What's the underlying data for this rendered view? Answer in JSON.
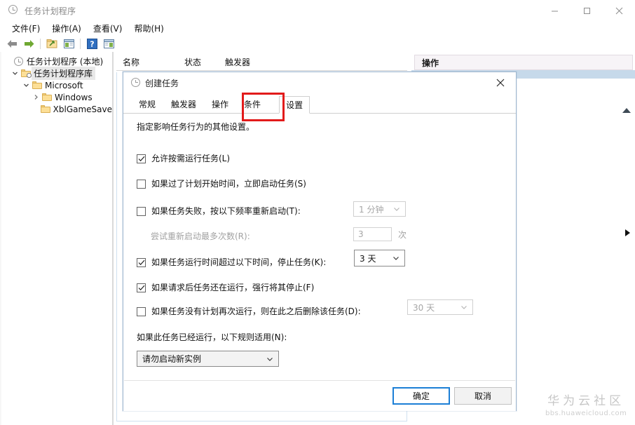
{
  "window": {
    "title": "任务计划程序",
    "icon": "clock-icon",
    "controls": {
      "minimize": "minimize-icon",
      "maximize": "maximize-icon",
      "close": "close-icon"
    }
  },
  "menubar": {
    "items": [
      {
        "label": "文件(F)",
        "name": "menu-file"
      },
      {
        "label": "操作(A)",
        "name": "menu-action"
      },
      {
        "label": "查看(V)",
        "name": "menu-view"
      },
      {
        "label": "帮助(H)",
        "name": "menu-help"
      }
    ]
  },
  "toolbar": {
    "buttons": [
      {
        "name": "back-arrow-icon"
      },
      {
        "name": "forward-arrow-icon"
      },
      {
        "name": "new-folder-icon"
      },
      {
        "name": "properties-icon"
      },
      {
        "name": "help-icon"
      },
      {
        "name": "show-pane-icon"
      }
    ]
  },
  "tree": {
    "nodes": [
      {
        "label": "任务计划程序 (本地)",
        "icon": "clock-icon",
        "indent": 0,
        "chevron": "none",
        "selected": false
      },
      {
        "label": "任务计划程序库",
        "icon": "folder-clock-icon",
        "indent": 1,
        "chevron": "down",
        "selected": true
      },
      {
        "label": "Microsoft",
        "icon": "folder-icon",
        "indent": 2,
        "chevron": "down",
        "selected": false
      },
      {
        "label": "Windows",
        "icon": "folder-icon",
        "indent": 3,
        "chevron": "right",
        "selected": false
      },
      {
        "label": "XblGameSave",
        "icon": "folder-icon",
        "indent": 3,
        "chevron": "none",
        "selected": false
      }
    ]
  },
  "list": {
    "columns": [
      "名称",
      "状态",
      "触发器"
    ]
  },
  "actions_pane": {
    "title": "操作"
  },
  "dialog": {
    "title": "创建任务",
    "icon": "clock-icon",
    "close_label": "关闭",
    "tabs": [
      {
        "label": "常规",
        "active": false
      },
      {
        "label": "触发器",
        "active": false
      },
      {
        "label": "操作",
        "active": false
      },
      {
        "label": "条件",
        "active": false
      },
      {
        "label": "设置",
        "active": true
      }
    ],
    "description": "指定影响任务行为的其他设置。",
    "options": [
      {
        "label": "允许按需运行任务(L)",
        "checked": true,
        "disabled": false,
        "accel": "L"
      },
      {
        "label": "如果过了计划开始时间，立即启动任务(S)",
        "checked": false,
        "disabled": false,
        "accel": "S"
      },
      {
        "label": "如果任务失败，按以下频率重新启动(T):",
        "checked": false,
        "disabled": false,
        "accel": "T"
      },
      {
        "label": "尝试重新启动最多次数(R):",
        "checked": null,
        "disabled": true,
        "accel": "R"
      },
      {
        "label": "如果任务运行时间超过以下时间，停止任务(K):",
        "checked": true,
        "disabled": false,
        "accel": "K"
      },
      {
        "label": "如果请求后任务还在运行，强行将其停止(F)",
        "checked": true,
        "disabled": false,
        "accel": "F"
      },
      {
        "label": "如果任务没有计划再次运行，则在此之后删除该任务(D):",
        "checked": false,
        "disabled": false,
        "accel": "D"
      }
    ],
    "controls": {
      "restart_interval": {
        "value": "1 分钟",
        "disabled": true
      },
      "restart_attempts": {
        "value": "3",
        "disabled": true,
        "unit": "次"
      },
      "stop_after": {
        "value": "3 天",
        "disabled": false
      },
      "delete_after": {
        "value": "30 天",
        "disabled": true
      }
    },
    "rules_label": "如果此任务已经运行，以下规则适用(N):",
    "rules_select": {
      "value": "请勿启动新实例"
    },
    "buttons": {
      "ok": "确定",
      "cancel": "取消"
    }
  },
  "watermark": {
    "main": "华为云社区",
    "sub": "bbs.huaweicloud.com"
  },
  "colors": {
    "accent": "#1c7fd6",
    "highlight_box": "#e21b1b",
    "actions_header_bg": "#f7f4f7",
    "selection_bg": "#e8e8e8"
  }
}
